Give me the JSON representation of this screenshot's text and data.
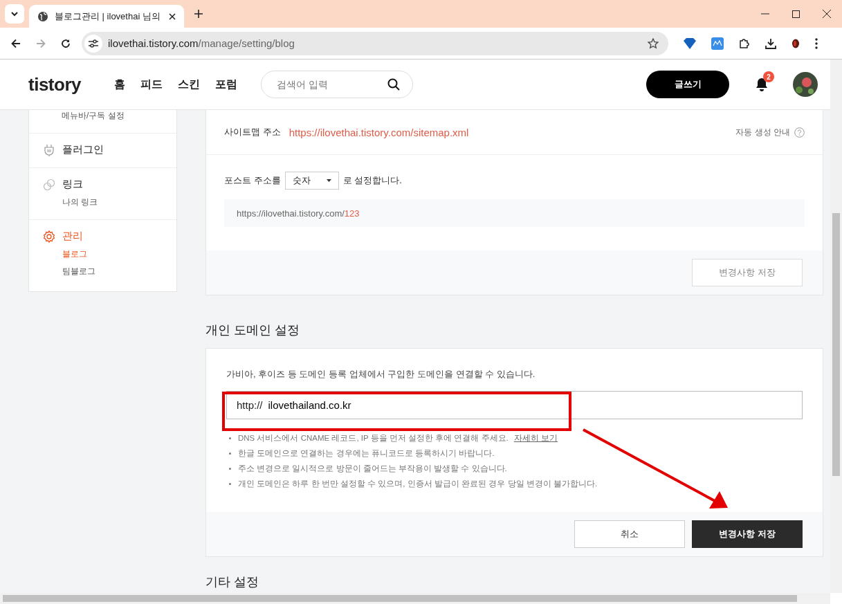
{
  "browser": {
    "tab_title": "블로그관리 | ilovethai 님의",
    "url_host": "ilovethai.tistory.com",
    "url_path": "/manage/setting/blog"
  },
  "header": {
    "logo": "tistory",
    "nav": [
      "홈",
      "피드",
      "스킨",
      "포럼"
    ],
    "search": {
      "placeholder": "검색어 입력"
    },
    "write_button": "글쓰기",
    "notification_count": "2"
  },
  "sidebar": {
    "groups": [
      {
        "kind": "none",
        "sub_items": [
          {
            "label": "메뉴바/구독 설정",
            "selected": false
          }
        ]
      },
      {
        "kind": "plug",
        "title": "플러그인",
        "selected": false
      },
      {
        "kind": "link",
        "title": "링크",
        "selected": false,
        "sub_items": [
          {
            "label": "나의 링크",
            "selected": false
          }
        ]
      },
      {
        "kind": "gear",
        "title": "관리",
        "selected": true,
        "sub_items": [
          {
            "label": "블로그",
            "selected": true
          },
          {
            "label": "팀블로그",
            "selected": false
          }
        ]
      }
    ]
  },
  "address_card": {
    "sitemap_label": "사이트맵 주소",
    "sitemap_url": "https://ilovethai.tistory.com/sitemap.xml",
    "help": "자동 생성 안내",
    "post_prefix": "포스트 주소를",
    "post_select": "숫자",
    "post_suffix": "로 설정합니다.",
    "preview_base": "https://ilovethai.tistory.com/",
    "preview_tail": "123",
    "save_button": {
      "label": "변경사항 저장",
      "disabled": true
    }
  },
  "domain": {
    "heading": "개인 도메인 설정",
    "description": "가비아, 후이즈 등 도메인 등록 업체에서 구입한 도메인을 연결할 수 있습니다.",
    "prefix": "http://",
    "value": "ilovethailand.co.kr",
    "notes": [
      {
        "text": "DNS 서비스에서 CNAME 레코드, IP 등을 먼저 설정한 후에 연결해 주세요.",
        "link": "자세히 보기"
      },
      {
        "text": "한글 도메인으로 연결하는 경우에는 퓨니코드로 등록하시기 바랍니다."
      },
      {
        "text": "주소 변경으로 일시적으로 방문이 줄어드는 부작용이 발생할 수 있습니다."
      },
      {
        "text": "개인 도메인은 하루 한 번만 설정할 수 있으며, 인증서 발급이 완료된 경우 당일 변경이 불가합니다."
      }
    ],
    "cancel_button": "취소",
    "save_button": {
      "label": "변경사항 저장",
      "disabled": false
    }
  },
  "next_section": "기타 설정"
}
